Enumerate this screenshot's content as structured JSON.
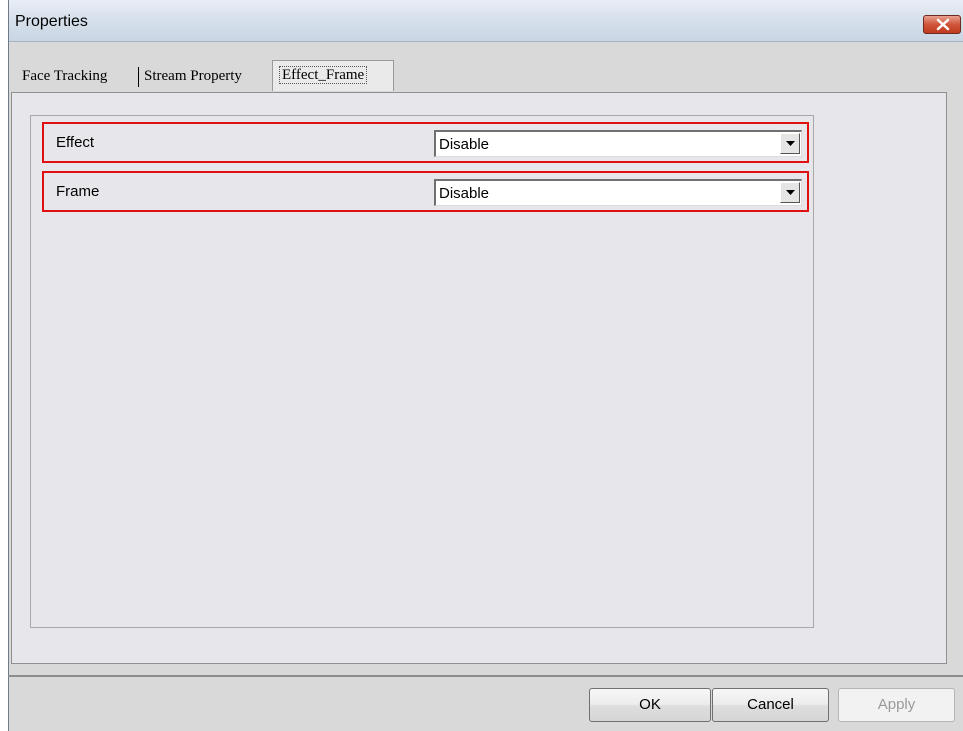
{
  "window": {
    "title": "Properties"
  },
  "tabs": [
    {
      "label": "Face Tracking",
      "selected": false
    },
    {
      "label": "Stream Property",
      "selected": false
    },
    {
      "label": "Effect_Frame",
      "selected": true
    }
  ],
  "settings": [
    {
      "label": "Effect",
      "value": "Disable"
    },
    {
      "label": "Frame",
      "value": "Disable"
    }
  ],
  "buttons": {
    "ok": "OK",
    "cancel": "Cancel",
    "apply": "Apply"
  },
  "colors": {
    "highlight": "#e01010",
    "panel": "#e7e6eb",
    "window": "#d9d9d9"
  },
  "icons": {
    "close": "close-icon",
    "dropdown": "chevron-down-icon"
  }
}
